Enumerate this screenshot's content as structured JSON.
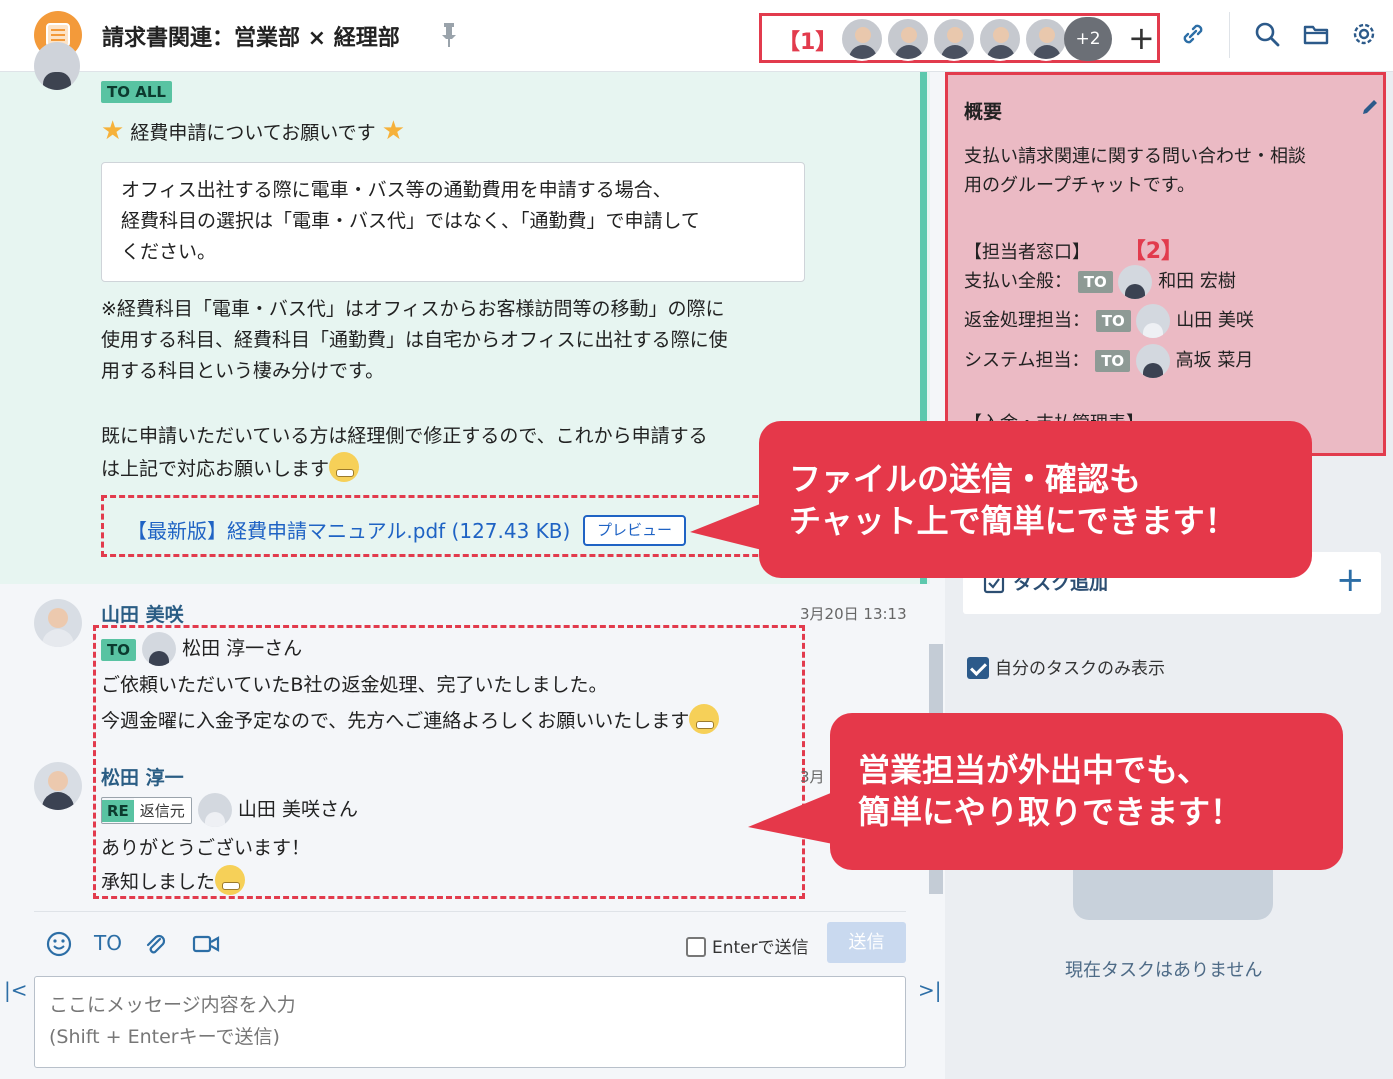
{
  "header": {
    "room_title": "請求書関連：営業部 × 経理部",
    "member_label_num": "【1】",
    "more_members": "+2",
    "add_member": "+"
  },
  "message_highlight": {
    "to_all": "TO ALL",
    "subject": "経費申請についてお願いです",
    "quote_lines": [
      "オフィス出社する際に電車・バス等の通勤費用を申請する場合、",
      "経費科目の選択は「電車・バス代」ではなく、「通勤費」で申請して",
      "ください。"
    ],
    "note_lines": [
      "※経費科目「電車・バス代」はオフィスからお客様訪問等の移動」の際に",
      "使用する科目、経費科目「通勤費」は自宅からオフィスに出社する際に使",
      "用する科目という棲み分けです。"
    ],
    "closing_lines": [
      "既に申請いただいている方は経理側で修正するので、これから申請する",
      "は上記で対応お願いします"
    ],
    "file_name": "【最新版】経費申請マニュアル.pdf (127.43 KB)",
    "preview_label": "プレビュー"
  },
  "message2": {
    "sender": "山田 美咲",
    "timestamp": "3月20日 13:13",
    "to_label": "TO",
    "to_name": "松田 淳一さん",
    "line1": "ご依頼いただいていたB社の返金処理、完了いたしました。",
    "line2": "今週金曜に入金予定なので、先方へご連絡よろしくお願いいたします"
  },
  "message3": {
    "sender": "松田 淳一",
    "timestamp": "3月",
    "re_label": "RE",
    "re_source": "返信元",
    "reply_name": "山田 美咲さん",
    "line1": "ありがとうございます！",
    "line2": "承知しました"
  },
  "composer": {
    "to_button": "TO",
    "enter_send_label": "Enterで送信",
    "send_label": "送信",
    "placeholder_line1": "ここにメッセージ内容を入力",
    "placeholder_line2": "(Shift + Enterキーで送信)",
    "nav_left": "|<",
    "nav_right": ">|"
  },
  "overview": {
    "title": "概要",
    "desc_lines": [
      "支払い請求関連に関する問い合わせ・相談",
      "用のグループチャットです。"
    ],
    "contacts_heading": "【担当者窓口】",
    "label_num": "【2】",
    "to_label": "TO",
    "contacts": [
      {
        "role": "支払い全般：",
        "name": "和田 宏樹"
      },
      {
        "role": "返金処理担当：",
        "name": "山田 美咲"
      },
      {
        "role": "システム担当：",
        "name": "高坂 菜月"
      }
    ],
    "cut_line": "【入金・支払管理表】"
  },
  "tasks": {
    "add_label": "タスク追加",
    "add_plus": "+",
    "filter_label": "自分のタスクのみ表示",
    "empty_label": "現在タスクはありません"
  },
  "callouts": {
    "file_lines": [
      "ファイルの送信・確認も",
      "チャット上で簡単にできます！"
    ],
    "sales_lines": [
      "営業担当が外出中でも、",
      "簡単にやり取りできます！"
    ]
  },
  "colors": {
    "accent_red": "#e5384a",
    "highlight_bg": "#e7f5f1",
    "to_badge": "#59c3a2",
    "link_blue": "#1f63c4"
  }
}
